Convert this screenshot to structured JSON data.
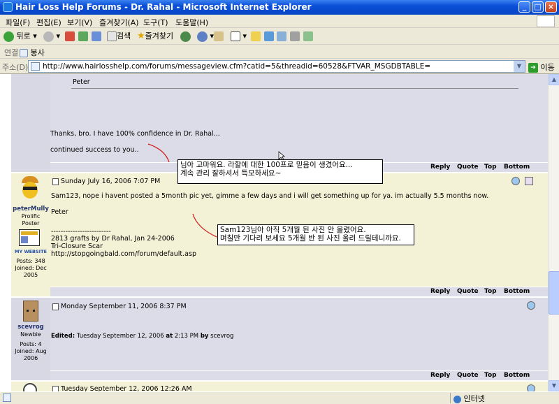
{
  "window": {
    "title": "Hair Loss Help Forums - Dr. Rahal - Microsoft Internet Explorer"
  },
  "menu": [
    "파일(F)",
    "편집(E)",
    "보기(V)",
    "즐겨찾기(A)",
    "도구(T)",
    "도움말(H)"
  ],
  "toolbar": {
    "back": "뒤로",
    "search": "검색",
    "favorites": "즐겨찾기"
  },
  "links": {
    "label": "연결",
    "item": "봉사"
  },
  "address": {
    "label": "주소(D)",
    "url": "http://www.hairlosshelp.com/forums/messageview.cfm?catid=5&threadid=60528&FTVAR_MSGDBTABLE=",
    "go": "이동"
  },
  "status": {
    "zone": "인터넷"
  },
  "actions": {
    "reply": "Reply",
    "quote": "Quote",
    "top": "Top",
    "bottom": "Bottom"
  },
  "posts": [
    {
      "quote_author": "Peter",
      "line1": "Thanks, bro. I have 100% confidence in Dr. Rahal...",
      "line2": "continued success to you..",
      "note1": "님아 고마워요. 라할에 대한 100프로 믿음이 생겼어요...",
      "note2": "계속 관리 잘하셔서 득모하세요~"
    },
    {
      "date": "Sunday July 16, 2006 7:07 PM",
      "user": "peterMully",
      "rank1": "Prolific",
      "rank2": "Poster",
      "website": "MY WEBSITE",
      "posts": "Posts: 348",
      "joined1": "Joined: Dec",
      "joined2": "2005",
      "body1": "Sam123, nope i havent posted a 5month pic yet, gimme a few days and i will get something up for ya. im actually 5.5 months now.",
      "body2": "Peter",
      "sig_rule": "-------------------------",
      "sig1": "2813 grafts by Dr Rahal, Jan 24-2006",
      "sig2": "Tri-Closure Scar",
      "sig3": "http://stopgoingbald.com/forum/default.asp",
      "note1": "Sam123님아 아직 5개월 된 사진 안 올렸어요.",
      "note2": "며칠만 기다려 보세요 5개월 반 된 사진 올려 드릴테니까요."
    },
    {
      "date": "Monday September 11, 2006 8:37 PM",
      "user": "scevrog",
      "rank1": "Newbie",
      "posts": "Posts: 4",
      "joined1": "Joined: Aug",
      "joined2": "2006",
      "edited_prefix": "Edited:",
      "edited_date": "Tuesday September 12, 2006",
      "edited_at": "at",
      "edited_time": "2:13 PM",
      "edited_by": "by",
      "edited_user": "scevrog"
    },
    {
      "date": "Tuesday September 12, 2006 12:26 AM"
    }
  ]
}
